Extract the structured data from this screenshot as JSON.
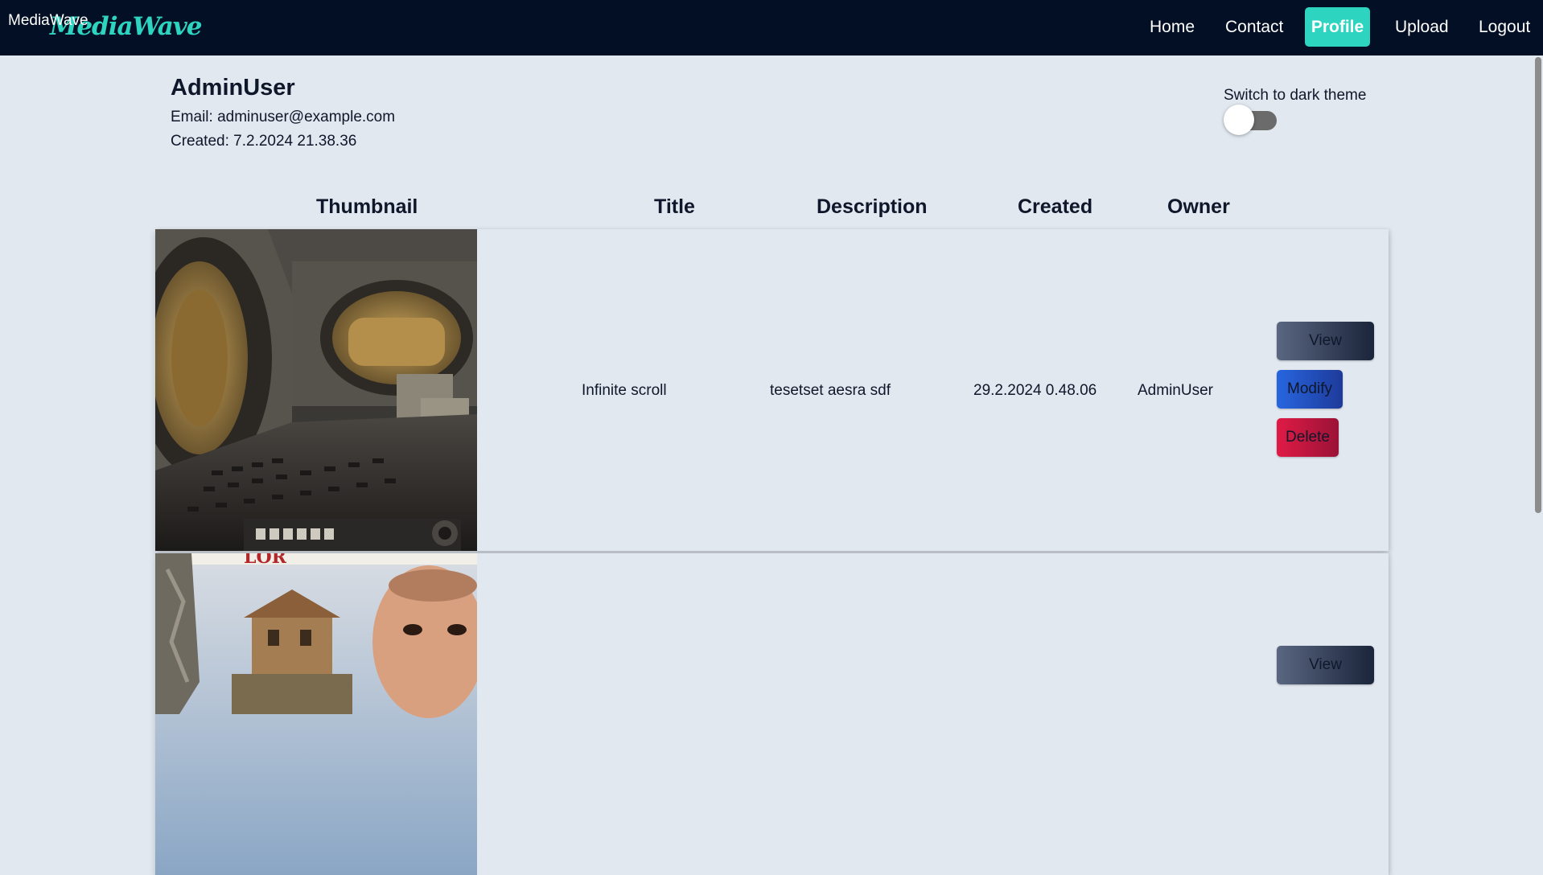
{
  "brand": {
    "alt_text": "MediaWave",
    "logo_text": "MediaWave"
  },
  "nav": {
    "home": "Home",
    "contact": "Contact",
    "profile": "Profile",
    "upload": "Upload",
    "logout": "Logout",
    "active": "Profile"
  },
  "profile": {
    "username": "AdminUser",
    "email_line": "Email: adminuser@example.com",
    "created_line": "Created: 7.2.2024 21.38.36"
  },
  "theme": {
    "label": "Switch to dark theme",
    "dark_enabled": false
  },
  "table": {
    "headers": [
      "Thumbnail",
      "Title",
      "Description",
      "Created",
      "Owner"
    ],
    "rows": [
      {
        "thumbnail_icon": "spaceship-interior-image",
        "title": "Infinite scroll",
        "description": "tesetset aesra sdf",
        "created": "29.2.2024 0.48.06",
        "owner": "AdminUser",
        "actions": [
          "View",
          "Modify",
          "Delete"
        ]
      },
      {
        "thumbnail_icon": "poster-image",
        "actions": [
          "View"
        ]
      }
    ]
  },
  "colors": {
    "nav_bg": "#020f24",
    "page_bg": "#e2e8f0",
    "accent": "#2dd4bf",
    "view_button": "#3b475e",
    "modify_button": "#2352c2",
    "delete_button": "#c21840"
  }
}
